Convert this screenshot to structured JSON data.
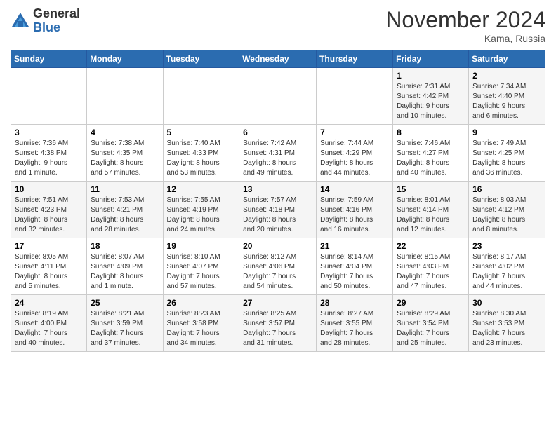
{
  "header": {
    "logo_general": "General",
    "logo_blue": "Blue",
    "month_title": "November 2024",
    "location": "Kama, Russia"
  },
  "days_of_week": [
    "Sunday",
    "Monday",
    "Tuesday",
    "Wednesday",
    "Thursday",
    "Friday",
    "Saturday"
  ],
  "weeks": [
    [
      {
        "day": "",
        "info": ""
      },
      {
        "day": "",
        "info": ""
      },
      {
        "day": "",
        "info": ""
      },
      {
        "day": "",
        "info": ""
      },
      {
        "day": "",
        "info": ""
      },
      {
        "day": "1",
        "info": "Sunrise: 7:31 AM\nSunset: 4:42 PM\nDaylight: 9 hours\nand 10 minutes."
      },
      {
        "day": "2",
        "info": "Sunrise: 7:34 AM\nSunset: 4:40 PM\nDaylight: 9 hours\nand 6 minutes."
      }
    ],
    [
      {
        "day": "3",
        "info": "Sunrise: 7:36 AM\nSunset: 4:38 PM\nDaylight: 9 hours\nand 1 minute."
      },
      {
        "day": "4",
        "info": "Sunrise: 7:38 AM\nSunset: 4:35 PM\nDaylight: 8 hours\nand 57 minutes."
      },
      {
        "day": "5",
        "info": "Sunrise: 7:40 AM\nSunset: 4:33 PM\nDaylight: 8 hours\nand 53 minutes."
      },
      {
        "day": "6",
        "info": "Sunrise: 7:42 AM\nSunset: 4:31 PM\nDaylight: 8 hours\nand 49 minutes."
      },
      {
        "day": "7",
        "info": "Sunrise: 7:44 AM\nSunset: 4:29 PM\nDaylight: 8 hours\nand 44 minutes."
      },
      {
        "day": "8",
        "info": "Sunrise: 7:46 AM\nSunset: 4:27 PM\nDaylight: 8 hours\nand 40 minutes."
      },
      {
        "day": "9",
        "info": "Sunrise: 7:49 AM\nSunset: 4:25 PM\nDaylight: 8 hours\nand 36 minutes."
      }
    ],
    [
      {
        "day": "10",
        "info": "Sunrise: 7:51 AM\nSunset: 4:23 PM\nDaylight: 8 hours\nand 32 minutes."
      },
      {
        "day": "11",
        "info": "Sunrise: 7:53 AM\nSunset: 4:21 PM\nDaylight: 8 hours\nand 28 minutes."
      },
      {
        "day": "12",
        "info": "Sunrise: 7:55 AM\nSunset: 4:19 PM\nDaylight: 8 hours\nand 24 minutes."
      },
      {
        "day": "13",
        "info": "Sunrise: 7:57 AM\nSunset: 4:18 PM\nDaylight: 8 hours\nand 20 minutes."
      },
      {
        "day": "14",
        "info": "Sunrise: 7:59 AM\nSunset: 4:16 PM\nDaylight: 8 hours\nand 16 minutes."
      },
      {
        "day": "15",
        "info": "Sunrise: 8:01 AM\nSunset: 4:14 PM\nDaylight: 8 hours\nand 12 minutes."
      },
      {
        "day": "16",
        "info": "Sunrise: 8:03 AM\nSunset: 4:12 PM\nDaylight: 8 hours\nand 8 minutes."
      }
    ],
    [
      {
        "day": "17",
        "info": "Sunrise: 8:05 AM\nSunset: 4:11 PM\nDaylight: 8 hours\nand 5 minutes."
      },
      {
        "day": "18",
        "info": "Sunrise: 8:07 AM\nSunset: 4:09 PM\nDaylight: 8 hours\nand 1 minute."
      },
      {
        "day": "19",
        "info": "Sunrise: 8:10 AM\nSunset: 4:07 PM\nDaylight: 7 hours\nand 57 minutes."
      },
      {
        "day": "20",
        "info": "Sunrise: 8:12 AM\nSunset: 4:06 PM\nDaylight: 7 hours\nand 54 minutes."
      },
      {
        "day": "21",
        "info": "Sunrise: 8:14 AM\nSunset: 4:04 PM\nDaylight: 7 hours\nand 50 minutes."
      },
      {
        "day": "22",
        "info": "Sunrise: 8:15 AM\nSunset: 4:03 PM\nDaylight: 7 hours\nand 47 minutes."
      },
      {
        "day": "23",
        "info": "Sunrise: 8:17 AM\nSunset: 4:02 PM\nDaylight: 7 hours\nand 44 minutes."
      }
    ],
    [
      {
        "day": "24",
        "info": "Sunrise: 8:19 AM\nSunset: 4:00 PM\nDaylight: 7 hours\nand 40 minutes."
      },
      {
        "day": "25",
        "info": "Sunrise: 8:21 AM\nSunset: 3:59 PM\nDaylight: 7 hours\nand 37 minutes."
      },
      {
        "day": "26",
        "info": "Sunrise: 8:23 AM\nSunset: 3:58 PM\nDaylight: 7 hours\nand 34 minutes."
      },
      {
        "day": "27",
        "info": "Sunrise: 8:25 AM\nSunset: 3:57 PM\nDaylight: 7 hours\nand 31 minutes."
      },
      {
        "day": "28",
        "info": "Sunrise: 8:27 AM\nSunset: 3:55 PM\nDaylight: 7 hours\nand 28 minutes."
      },
      {
        "day": "29",
        "info": "Sunrise: 8:29 AM\nSunset: 3:54 PM\nDaylight: 7 hours\nand 25 minutes."
      },
      {
        "day": "30",
        "info": "Sunrise: 8:30 AM\nSunset: 3:53 PM\nDaylight: 7 hours\nand 23 minutes."
      }
    ]
  ]
}
